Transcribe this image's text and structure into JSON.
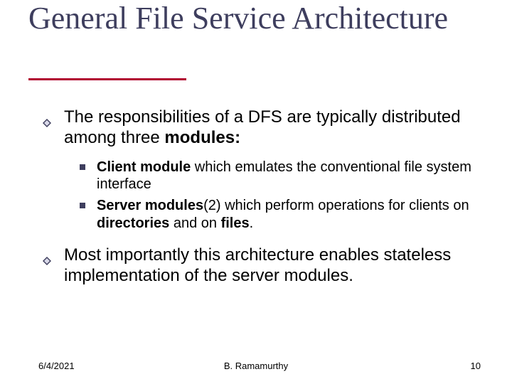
{
  "title": "General File Service Architecture",
  "bullets": {
    "p1_pre": "The responsibilities of a DFS are typically distributed among three ",
    "p1_bold": "modules:",
    "sub1_bold": "Client module",
    "sub1_rest": " which emulates the conventional file system interface",
    "sub2_bold": "Server modules",
    "sub2_mid": "(2) which perform operations for clients on ",
    "sub2_dirs": "directories",
    "sub2_and": " and on ",
    "sub2_files": "files",
    "sub2_dot": ".",
    "p2": "Most importantly this architecture enables stateless implementation of the server modules."
  },
  "footer": {
    "date": "6/4/2021",
    "author": "B. Ramamurthy",
    "page": "10"
  }
}
